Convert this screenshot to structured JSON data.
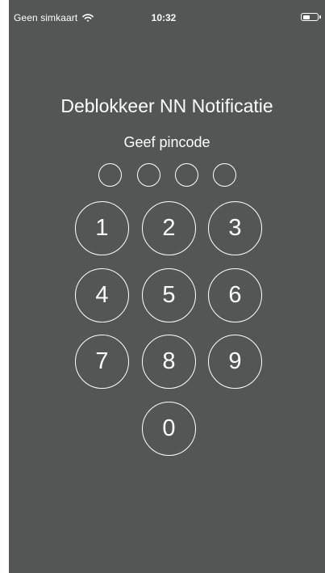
{
  "status_bar": {
    "carrier": "Geen simkaart",
    "time": "10:32",
    "icons": [
      "wifi-icon",
      "battery-icon"
    ]
  },
  "lock_screen": {
    "title": "Deblokkeer NN Notificatie",
    "subtitle": "Geef pincode",
    "pin_length": 4,
    "pin_entered": 0,
    "keys": [
      "1",
      "2",
      "3",
      "4",
      "5",
      "6",
      "7",
      "8",
      "9",
      "0"
    ]
  },
  "colors": {
    "background": "#545555",
    "foreground": "#ffffff"
  }
}
